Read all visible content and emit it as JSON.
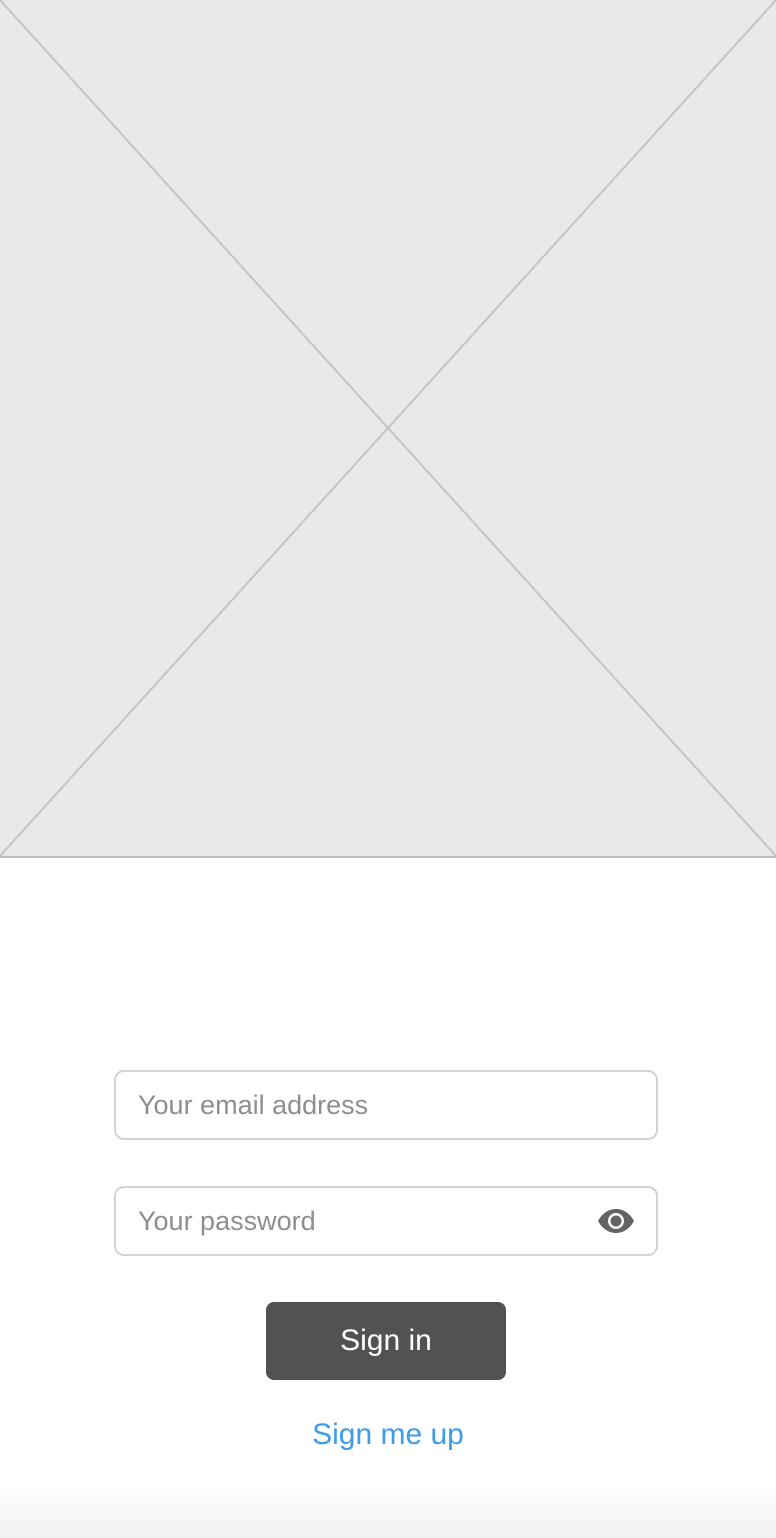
{
  "login": {
    "email_placeholder": "Your email address",
    "email_value": "",
    "password_placeholder": "Your password",
    "password_value": "",
    "password_toggle_icon": "eye-icon",
    "signin_label": "Sign in",
    "signup_label": "Sign me up"
  },
  "colors": {
    "primary_button": "#525252",
    "link": "#3d9be9",
    "placeholder_background": "#e9e9e9"
  }
}
